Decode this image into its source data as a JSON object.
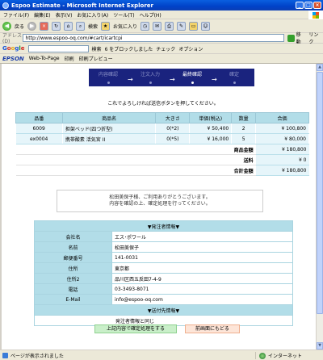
{
  "window": {
    "title": "Espoo Estimate - Microsoft Internet Explorer"
  },
  "menu": [
    "ファイル(F)",
    "編集(E)",
    "表示(V)",
    "お気に入り(A)",
    "ツール(T)",
    "ヘルプ(H)"
  ],
  "toolbar": {
    "back": "戻る",
    "search": "検索",
    "favorites": "お気に入り"
  },
  "address": {
    "label": "アドレス(D)",
    "url": "http://www.espoo-oq.com/#cart/icartcpi",
    "go": "移動",
    "links": "リンク"
  },
  "google": {
    "search": "検索",
    "blocked": "6 をブロックしました",
    "check": "チェック",
    "options": "オプション"
  },
  "epson": {
    "brand": "EPSON",
    "web_to_page": "Web-To-Page",
    "print": "印刷",
    "preview": "印刷プレビュー"
  },
  "steps": [
    {
      "label": "内容確認",
      "active": false
    },
    {
      "label": "注文入力",
      "active": false
    },
    {
      "label": "最終確認",
      "active": true
    },
    {
      "label": "確定",
      "active": false
    }
  ],
  "instruction": "これでよろしければ送信ボタンを押してください。",
  "cart": {
    "headers": [
      "品番",
      "商品名",
      "大きさ",
      "単価(税込)",
      "数量",
      "合価"
    ],
    "rows": [
      [
        "6009",
        "担架ベッド(四つ折型)",
        "0(*2)",
        "¥ 50,400",
        "2",
        "¥ 100,800"
      ],
      [
        "ex0004",
        "携帯酸素 活気宮 II",
        "0(*5)",
        "¥ 16,000",
        "5",
        "¥ 80,000"
      ]
    ],
    "subtotal_label": "商品金額",
    "subtotal_value": "¥ 180,800",
    "shipping_label": "送料",
    "shipping_value": "¥ 0",
    "total_label": "合計金額",
    "total_value": "¥ 180,800"
  },
  "notice": {
    "line1": "松田美保子様、ご利用ありがとうございます。",
    "line2": "内容を確認の上、確定処理を行ってください。"
  },
  "order": {
    "header": "▼発注者情報▼",
    "fields": [
      {
        "key": "会社名",
        "value": "エス･ポワール"
      },
      {
        "key": "名前",
        "value": "松田美保子"
      },
      {
        "key": "郵便番号",
        "value": "141-0031"
      },
      {
        "key": "住所",
        "value": "東京都"
      },
      {
        "key": "住所2",
        "value": "品川区西五反田7-4-9"
      },
      {
        "key": "電話",
        "value": "03-3493-8071"
      },
      {
        "key": "E-Mail",
        "value": "info@espoo-oq.com"
      }
    ],
    "ship_header": "▼送付先情報▼",
    "ship_value": "発注者情報と同じ"
  },
  "buttons": {
    "confirm": "上記内容で確定処理をする",
    "back": "前画面にもどる"
  },
  "status": {
    "text": "ページが表示されました",
    "zone": "インターネット"
  }
}
